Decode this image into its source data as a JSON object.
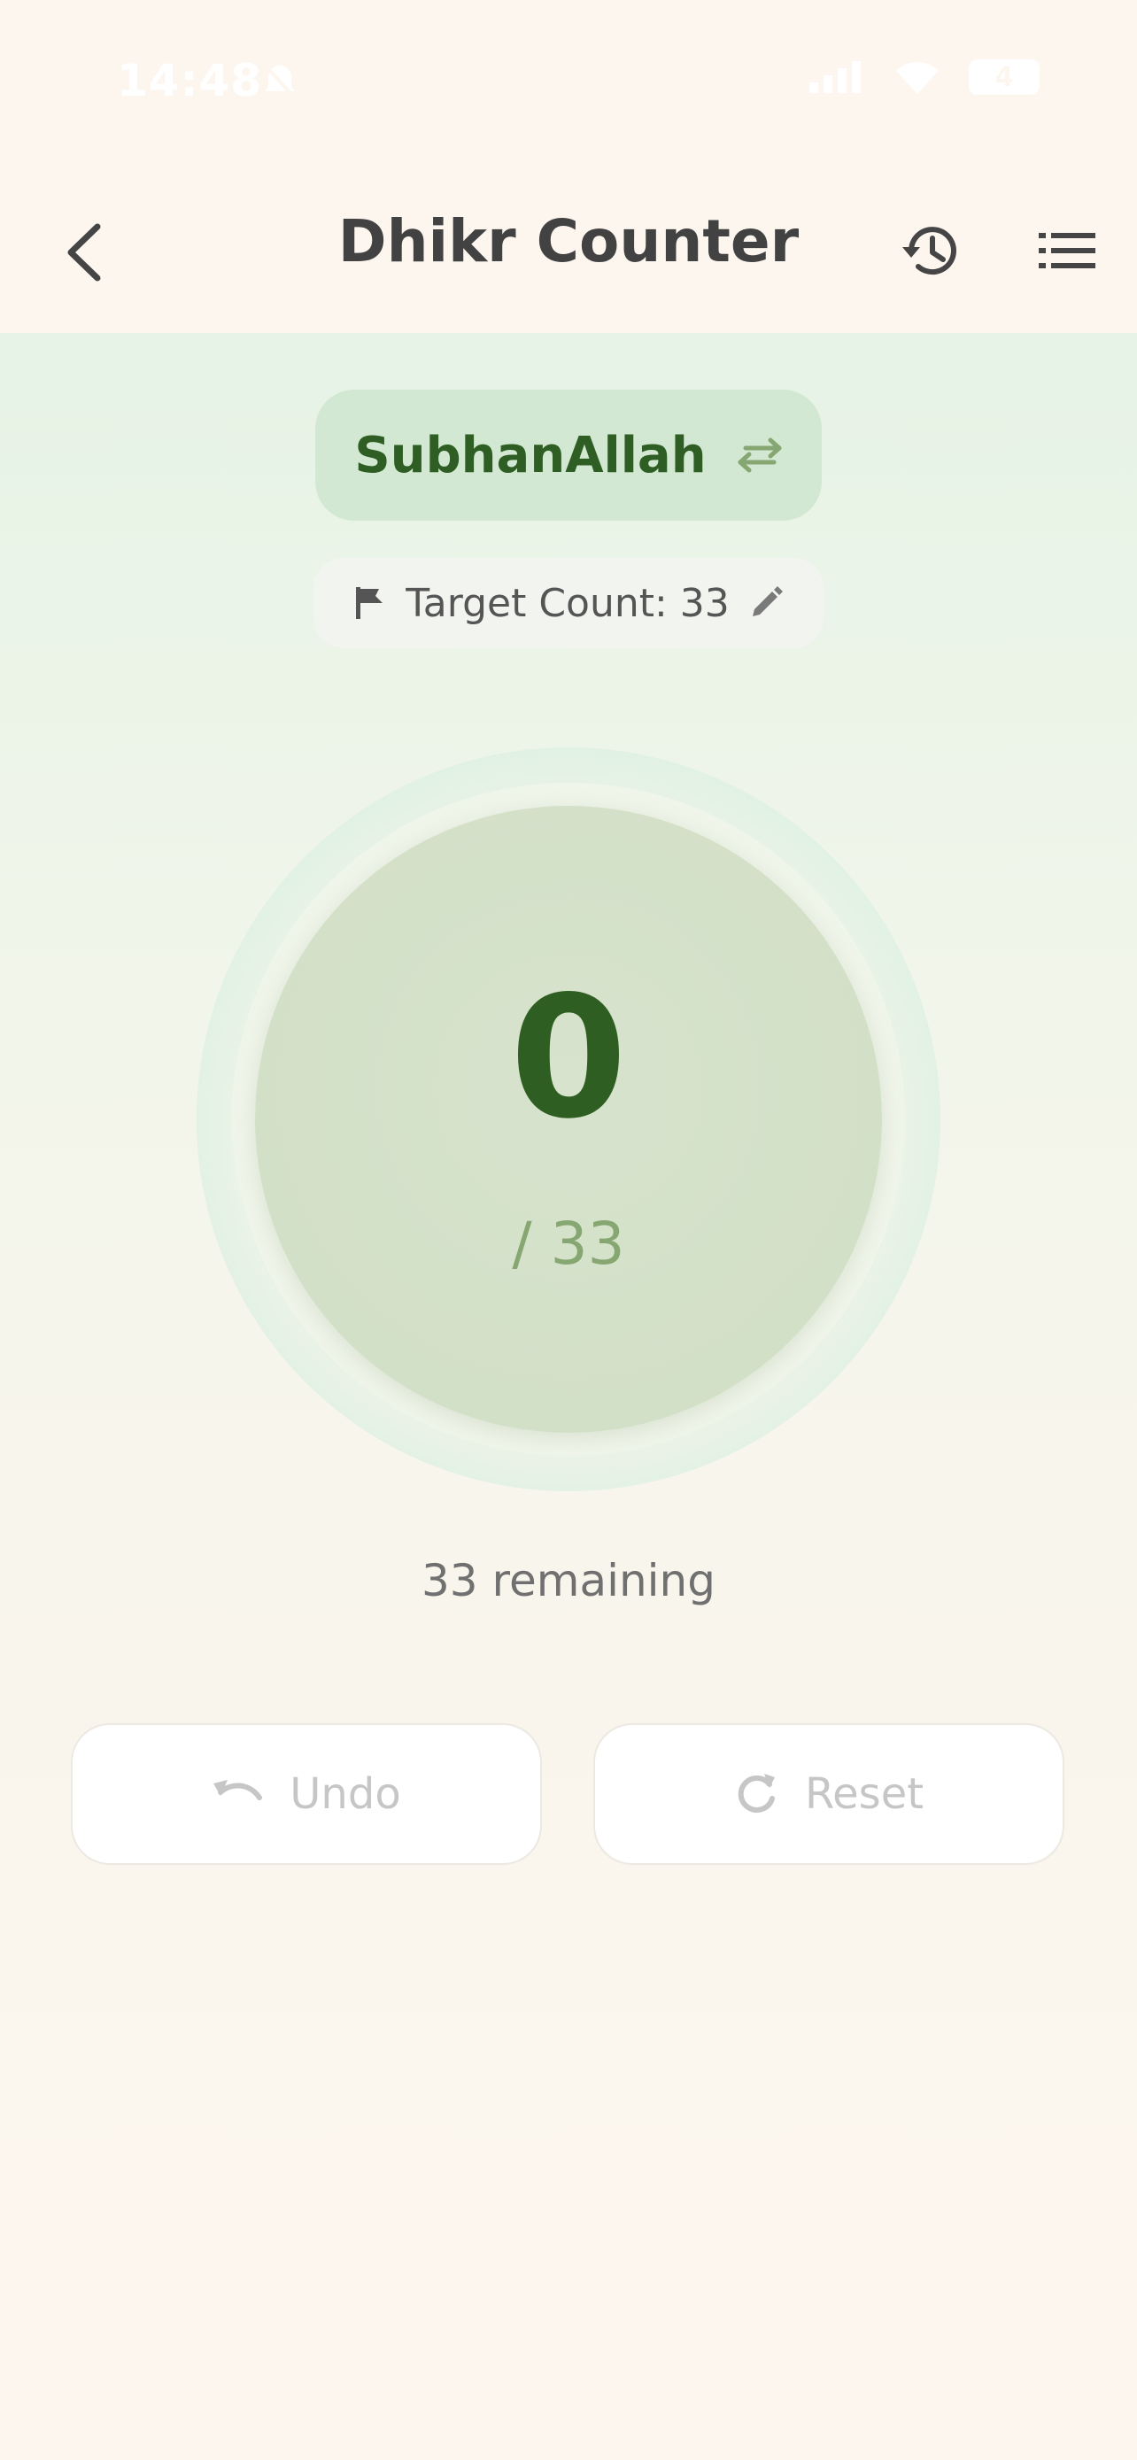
{
  "status_bar": {
    "time": "14:48",
    "battery": "4"
  },
  "app_bar": {
    "title": "Dhikr Counter"
  },
  "dhikr": {
    "name": "SubhanAllah"
  },
  "target": {
    "label": "Target Count: 33"
  },
  "counter": {
    "value": "0",
    "target_text": "/ 33",
    "remaining_text": "33 remaining"
  },
  "actions": {
    "undo_label": "Undo",
    "reset_label": "Reset"
  },
  "colors": {
    "accent_green": "#2f5e22",
    "pill_green": "#d3e8d2",
    "muted_green": "#86a672"
  }
}
